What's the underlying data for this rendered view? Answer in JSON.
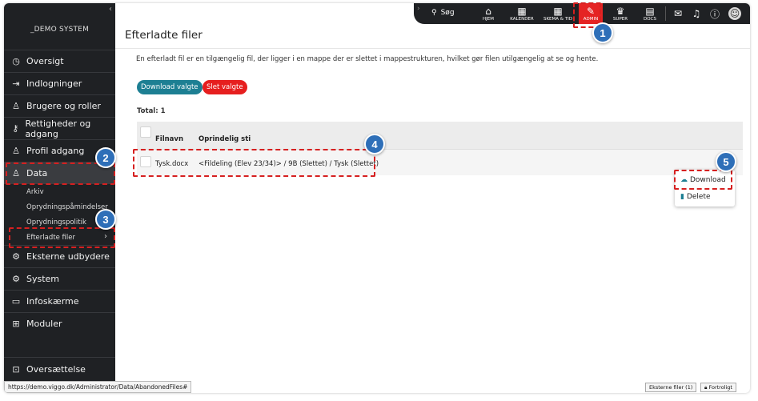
{
  "sidebar": {
    "system_name": "_DEMO SYSTEM",
    "collapse_glyph": "‹",
    "items": [
      {
        "label": "Oversigt",
        "icon": "gauge-icon"
      },
      {
        "label": "Indlogninger",
        "icon": "login-icon"
      },
      {
        "label": "Brugere og roller",
        "icon": "users-icon"
      },
      {
        "label": "Rettigheder og adgang",
        "icon": "key-icon"
      },
      {
        "label": "Profil adgang",
        "icon": "profile-access-icon"
      },
      {
        "label": "Data",
        "icon": "data-icon"
      }
    ],
    "sub_items": [
      "Arkiv",
      "Oprydningspåmindelser",
      "Oprydningspolitik",
      "Efterladte filer"
    ],
    "items_after": [
      {
        "label": "Eksterne udbydere",
        "icon": "external-icon"
      },
      {
        "label": "System",
        "icon": "system-icon"
      },
      {
        "label": "Infoskærme",
        "icon": "screen-icon"
      },
      {
        "label": "Moduler",
        "icon": "modules-icon"
      }
    ],
    "bottom_item": {
      "label": "Oversættelse",
      "icon": "translate-icon"
    },
    "status_url": "https://demo.viggo.dk/Administrator/Data/AbandonedFiles#"
  },
  "topbar": {
    "search_label": "Søg",
    "items": [
      {
        "label": "HJEM",
        "icon": "home-icon"
      },
      {
        "label": "KALENDER",
        "icon": "calendar-icon"
      },
      {
        "label": "SKEMA & TID",
        "icon": "schedule-icon"
      },
      {
        "label": "ADMIN",
        "icon": "wrench-icon"
      },
      {
        "label": "SUPER",
        "icon": "crown-icon"
      },
      {
        "label": "DOCS",
        "icon": "docs-icon"
      }
    ],
    "colors": {
      "bar": "#1f2124",
      "admin_active": "#e52323"
    }
  },
  "main": {
    "title": "Efterladte filer",
    "description": "En efterladt fil er en tilgængelig fil, der ligger i en mappe der er slettet i mappestrukturen, hvilket gør filen utilgængelig at se og hente.",
    "download_selected": "Download valgte",
    "delete_selected": "Slet valgte",
    "total": "Total: 1",
    "columns": [
      "Filnavn",
      "Oprindelig sti"
    ],
    "rows": [
      {
        "filename": "Tysk.docx",
        "path": "<Fildeling (Elev 23/34)> / 9B (Slettet) / Tysk (Slettet)"
      }
    ],
    "context_menu": [
      "Download",
      "Delete"
    ],
    "colors": {
      "download_btn": "#1d7f93",
      "delete_btn": "#e61f1f"
    }
  },
  "footer": {
    "external_files": "Eksterne filer (1)",
    "confidential": "Fortroligt"
  },
  "annotations": [
    "1",
    "2",
    "3",
    "4",
    "5"
  ]
}
